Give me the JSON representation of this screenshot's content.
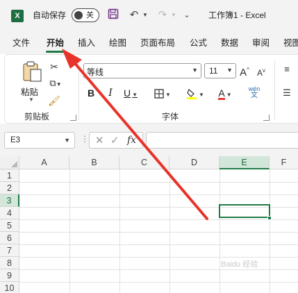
{
  "titlebar": {
    "logo": "X",
    "autosave_label": "自动保存",
    "autosave_state": "关",
    "doc_title": "工作簿1  -  Excel",
    "icons": [
      "excel-logo-icon",
      "save-icon",
      "undo-icon",
      "redo-icon",
      "customize-toolbar-icon"
    ]
  },
  "tabs": [
    {
      "label": "文件"
    },
    {
      "label": "开始",
      "active": true
    },
    {
      "label": "插入"
    },
    {
      "label": "绘图"
    },
    {
      "label": "页面布局"
    },
    {
      "label": "公式"
    },
    {
      "label": "数据"
    },
    {
      "label": "审阅"
    },
    {
      "label": "视图"
    }
  ],
  "ribbon": {
    "clipboard": {
      "paste_label": "粘贴",
      "group_label": "剪贴板"
    },
    "font": {
      "font_name": "等线",
      "font_size": "11",
      "group_label": "字体",
      "phonetic_top": "wén",
      "phonetic_bottom": "文"
    },
    "accent_colors": {
      "highlight": "#ffff00",
      "font_color": "#e53935"
    }
  },
  "formula_bar": {
    "name_box": "E3",
    "dots": "⋮",
    "cancel": "✕",
    "enter": "✓",
    "fx": "fx",
    "value": ""
  },
  "grid": {
    "columns": [
      "A",
      "B",
      "C",
      "D",
      "E",
      "F"
    ],
    "rows": [
      "1",
      "2",
      "3",
      "4",
      "5",
      "6",
      "7",
      "8",
      "9",
      "10"
    ],
    "selected_cell": "E3"
  },
  "annotation": {
    "arrow_color": "#e8332a",
    "points_to": "开始"
  },
  "watermark": "Baidu 经验",
  "colors": {
    "accent": "#1f7a45",
    "titlebar_bg": "#f3f3f3"
  }
}
